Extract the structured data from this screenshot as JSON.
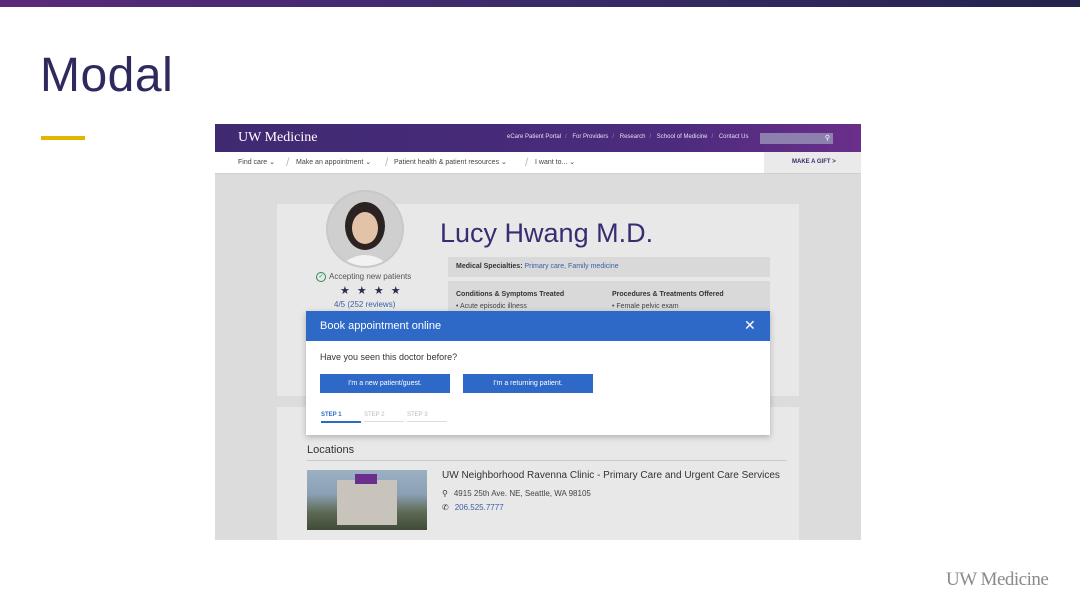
{
  "slide": {
    "title": "Modal",
    "footer_logo": "UW Medicine",
    "accent_color": "#e3b400",
    "title_color": "#2e2a5e"
  },
  "site": {
    "logo": "UW Medicine",
    "top_links": [
      "eCare Patient Portal",
      "For Providers",
      "Research",
      "School of Medicine",
      "Contact Us"
    ],
    "search_icon": "search-icon",
    "nav": [
      "Find care",
      "Make an appointment",
      "Patient health & patient resources",
      "I want to..."
    ],
    "make_gift": "MAKE A GIFT >"
  },
  "doctor": {
    "name": "Lucy Hwang M.D.",
    "accepting": "Accepting new patients",
    "stars": "★ ★ ★ ★",
    "rating": "4/5 (252 reviews)",
    "specialties_label": "Medical Specialties:",
    "specialties_value": "Primary care, Family medicine",
    "conditions_header": "Conditions & Symptoms Treated",
    "conditions_item": "• Acute episodic illness",
    "procedures_header": "Procedures & Treatments Offered",
    "procedures_item": "• Female pelvic exam"
  },
  "locations": {
    "title": "Locations",
    "name": "UW Neighborhood Ravenna Clinic - Primary Care and Urgent Care Services",
    "address": "4915 25th Ave. NE, Seattle, WA 98105",
    "phone": "206.525.7777"
  },
  "modal": {
    "title": "Book appointment online",
    "close": "✕",
    "question": "Have you seen this doctor before?",
    "new_patient": "I'm a new patient/guest.",
    "returning": "I'm a returning patient.",
    "steps": [
      "STEP 1",
      "STEP 2",
      "STEP 3"
    ],
    "accent_color": "#2f69c8"
  }
}
